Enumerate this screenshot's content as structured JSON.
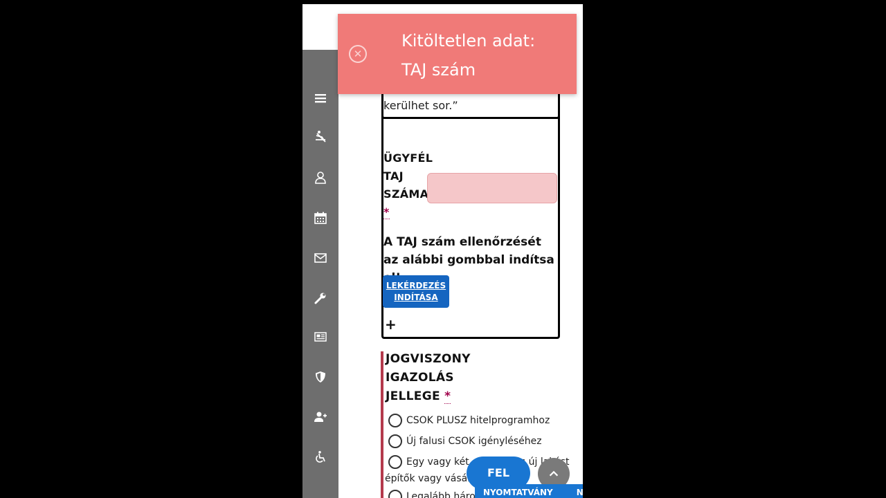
{
  "toast": {
    "line1": "Kitöltetlen adat:",
    "line2": "TAJ szám",
    "close_icon": "close-circle-icon",
    "color": "#f07a78"
  },
  "sidebar": {
    "items": [
      {
        "name": "menu",
        "icon": "hamburger-icon"
      },
      {
        "name": "leave",
        "icon": "lounger-icon"
      },
      {
        "name": "profile",
        "icon": "user-icon"
      },
      {
        "name": "calendar",
        "icon": "calendar-icon"
      },
      {
        "name": "messages",
        "icon": "mail-icon"
      },
      {
        "name": "tools",
        "icon": "wrench-icon"
      },
      {
        "name": "news",
        "icon": "newspaper-icon"
      },
      {
        "name": "security",
        "icon": "shield-icon"
      },
      {
        "name": "add-user",
        "icon": "user-plus-icon"
      },
      {
        "name": "accessibility",
        "icon": "wheelchair-icon"
      }
    ]
  },
  "form": {
    "quote_tail": "kerülhet sor.”",
    "taj_label_line1": "ÜGYFÉL",
    "taj_label_line2": "TAJ",
    "taj_label_line3": "SZÁMA:",
    "required_mark": "*",
    "taj_value": "",
    "check_instruction": "A TAJ szám ellenőrzését az alábbi gombbal indítsa el!",
    "query_button_line1": "LEKÉRDEZÉS",
    "query_button_line2": "INDÍTÁSA",
    "plus_label": "+",
    "jogviszony_line1": "JOGVISZONY",
    "jogviszony_line2": "IGAZOLÁS",
    "jogviszony_line3": "JELLEGE",
    "options": [
      "CSOK PLUSZ hitelprogramhoz",
      "Új falusi CSOK igényléséhez",
      "Egy vagy két gyermekes új lakást",
      "építők vagy vásárlók",
      "Legalább három"
    ]
  },
  "footer": {
    "fel_label": "FEL",
    "print_label_1": "NYOMTATVÁNY",
    "print_label_2": "NYOM",
    "up_icon": "chevron-up-icon"
  },
  "colors": {
    "primary": "#1565c0",
    "sidebar": "#6e6e6e",
    "error_input": "#f5c7c9",
    "required": "#a0004a"
  }
}
